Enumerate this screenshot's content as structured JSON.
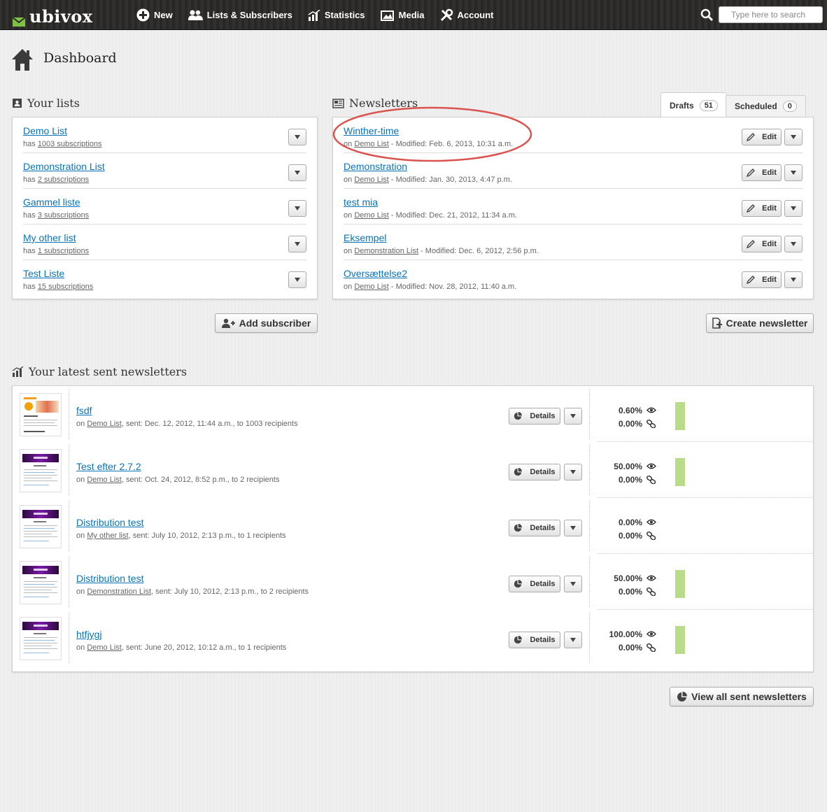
{
  "brand": {
    "name": "ubivox"
  },
  "nav": [
    {
      "label": "New",
      "icon": "plus-circle-icon"
    },
    {
      "label": "Lists & Subscribers",
      "icon": "users-icon"
    },
    {
      "label": "Statistics",
      "icon": "chart-icon"
    },
    {
      "label": "Media",
      "icon": "image-icon"
    },
    {
      "label": "Account",
      "icon": "tools-icon"
    }
  ],
  "search": {
    "placeholder": "Type here to search",
    "value": ""
  },
  "page": {
    "title": "Dashboard"
  },
  "lists": {
    "title": "Your lists",
    "items": [
      {
        "name": "Demo List",
        "prefix": "has",
        "subs": "1003 subscriptions"
      },
      {
        "name": "Demonstration List",
        "prefix": "has",
        "subs": "2 subscriptions"
      },
      {
        "name": "Gammel liste",
        "prefix": "has",
        "subs": "3 subscriptions"
      },
      {
        "name": "My other list",
        "prefix": "has",
        "subs": "1 subscriptions"
      },
      {
        "name": "Test Liste",
        "prefix": "has",
        "subs": "15 subscriptions"
      }
    ],
    "add_button": "Add subscriber"
  },
  "newsletters": {
    "title": "Newsletters",
    "tabs": [
      {
        "label": "Drafts",
        "count": "51"
      },
      {
        "label": "Scheduled",
        "count": "0"
      }
    ],
    "items": [
      {
        "name": "Winther-time",
        "on": "on",
        "list": "Demo List",
        "modified": " - Modified: Feb. 6, 2013, 10:31 a.m."
      },
      {
        "name": "Demonstration",
        "on": "on",
        "list": "Demo List",
        "modified": " - Modified: Jan. 30, 2013, 4:47 p.m."
      },
      {
        "name": "test mia",
        "on": "on",
        "list": "Demo List",
        "modified": " - Modified: Dec. 21, 2012, 11:34 a.m."
      },
      {
        "name": "Eksempel",
        "on": "on",
        "list": "Demonstration List",
        "modified": " - Modified: Dec. 6, 2012, 2:56 p.m."
      },
      {
        "name": "Oversættelse2",
        "on": "on",
        "list": "Demo List",
        "modified": " - Modified: Nov. 28, 2012, 11:40 a.m."
      }
    ],
    "edit_label": "Edit",
    "create_button": "Create newsletter"
  },
  "sent": {
    "title": "Your latest sent newsletters",
    "details_label": "Details",
    "items": [
      {
        "name": "fsdf",
        "on": "on",
        "list": "Demo List",
        "info": ", sent: Dec. 12, 2012, 11:44 a.m., to 1003 recipients",
        "open": "0.60%",
        "click": "0.00%",
        "bar": true,
        "thumb": "food"
      },
      {
        "name": "Test efter 2.7.2",
        "on": "on",
        "list": "Demo List",
        "info": ", sent: Oct. 24, 2012, 8:52 p.m., to 2 recipients",
        "open": "50.00%",
        "click": "0.00%",
        "bar": true,
        "thumb": "purple"
      },
      {
        "name": "Distribution test",
        "on": "on",
        "list": "My other list",
        "info": ", sent: July 10, 2012, 2:13 p.m., to 1 recipients",
        "open": "0.00%",
        "click": "0.00%",
        "bar": false,
        "thumb": "purple"
      },
      {
        "name": "Distribution test",
        "on": "on",
        "list": "Demonstration List",
        "info": ", sent: July 10, 2012, 2:13 p.m., to 2 recipients",
        "open": "50.00%",
        "click": "0.00%",
        "bar": true,
        "thumb": "purple"
      },
      {
        "name": "htfjygj",
        "on": "on",
        "list": "Demo List",
        "info": ", sent: June 20, 2012, 10:12 a.m., to 1 recipients",
        "open": "100.00%",
        "click": "0.00%",
        "bar": true,
        "thumb": "purple"
      }
    ],
    "view_all_button": "View all sent newsletters"
  },
  "colors": {
    "accent": "#0a73b7",
    "bar": "#b8dc8a",
    "highlight": "#d9534f",
    "topbar": "#2b2a28"
  }
}
